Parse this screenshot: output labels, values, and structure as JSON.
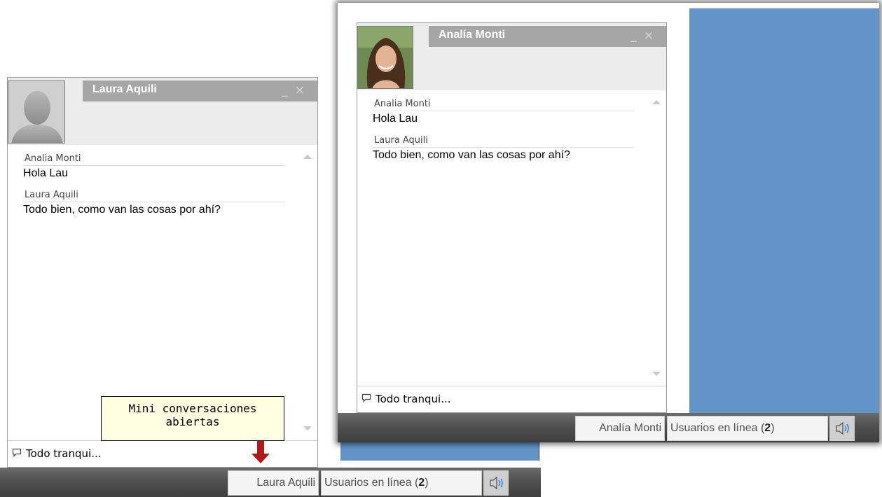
{
  "front_screen": {
    "chat": {
      "contact_name": "Analía Monti",
      "minimize_icon": "minimize-icon",
      "close_icon": "close-icon",
      "messages": [
        {
          "sender": "Analia Monti",
          "text": "Hola Lau"
        },
        {
          "sender": "Laura Aquili",
          "text": "Todo bien, como van las cosas por ahí?"
        }
      ],
      "input_value": "Todo tranqui..."
    },
    "taskbar": {
      "chat_tab": "Analía Monti",
      "online_prefix": "Usuarios en línea (",
      "online_count": "2",
      "online_suffix": ")",
      "sound_icon": "speaker-icon"
    }
  },
  "back_screen": {
    "chat": {
      "contact_name": "Laura Aquili",
      "minimize_icon": "minimize-icon",
      "close_icon": "close-icon",
      "messages": [
        {
          "sender": "Analia Monti",
          "text": "Hola Lau"
        },
        {
          "sender": "Laura Aquili",
          "text": "Todo bien, como van las cosas por ahí?"
        }
      ],
      "input_value": "Todo tranqui..."
    },
    "taskbar": {
      "chat_tab": "Laura Aquili",
      "online_prefix": "Usuarios en línea (",
      "online_count": "2",
      "online_suffix": ")",
      "sound_icon": "speaker-icon"
    }
  },
  "annotation": {
    "line1": "Mini conversaciones",
    "line2": "abiertas"
  },
  "colors": {
    "desktop_blue": "#6294c8",
    "title_bar_gray": "#a6a6a6",
    "taskbar_dark": "#4a4a4a",
    "tooltip_yellow": "#ffffe1",
    "arrow_red": "#b01818"
  }
}
